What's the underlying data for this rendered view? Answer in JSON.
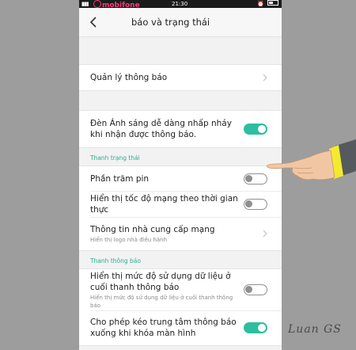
{
  "statusbar": {
    "carrier": "mobifone",
    "time": "21:30"
  },
  "header": {
    "title": "báo và trạng thái"
  },
  "group1": {
    "items": [
      {
        "label": "Quản lý thông báo"
      }
    ]
  },
  "group2": {
    "items": [
      {
        "label": "Đèn Ánh sáng dễ dàng nhấp nháy khi nhận được thông báo.",
        "enabled": true
      }
    ]
  },
  "section_status": {
    "title": "Thanh trạng thái",
    "items": [
      {
        "label": "Phần trăm pin",
        "enabled": false
      },
      {
        "label": "Hiển thị tốc độ mạng theo thời gian thực",
        "enabled": false
      },
      {
        "label": "Thông tin nhà cung cấp mạng",
        "sub": "Hiển thị logo nhà điều hành"
      }
    ]
  },
  "section_notif": {
    "title": "Thanh thông báo",
    "items": [
      {
        "label": "Hiển thị mức độ sử dụng dữ liệu ở cuối thanh thông báo",
        "sub": "Hiển thị mức độ sử dụng dữ liệu ở cuối thanh thông báo",
        "enabled": false
      },
      {
        "label": "Cho phép kéo trung tâm thông báo xuống khi khóa màn hình",
        "enabled": true
      }
    ]
  },
  "watermark": "Luan GS",
  "colors": {
    "accent": "#2bbf9f",
    "section_text": "#2bae91"
  }
}
